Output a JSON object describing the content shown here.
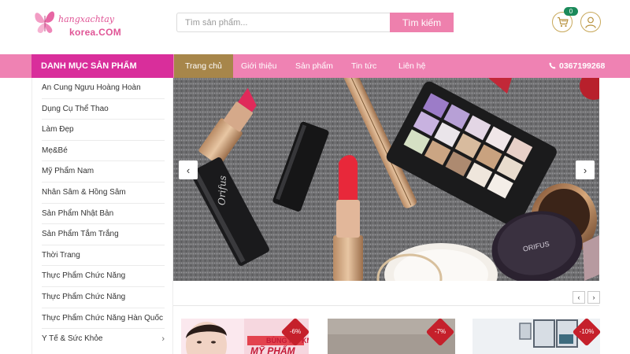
{
  "header": {
    "logo_line1": "hangxachtay",
    "logo_line2": "korea.COM",
    "search_placeholder": "Tìm sản phẩm...",
    "search_button": "Tìm kiếm",
    "cart_count": "0"
  },
  "nav": {
    "category_title": "DANH MỤC SẢN PHẨM",
    "items": [
      "Trang chủ",
      "Giới thiệu",
      "Sản phẩm",
      "Tin tức",
      "Liên hệ"
    ],
    "phone": "0367199268"
  },
  "sidebar": {
    "items": [
      "An Cung Ngưu Hoàng Hoàn",
      "Dụng Cụ Thể Thao",
      "Làm Đẹp",
      "Mẹ&Bé",
      "Mỹ Phẩm Nam",
      "Nhân Sâm & Hồng Sâm",
      "Sản Phẩm Nhật Bản",
      "Sản Phẩm Tắm Trắng",
      "Thời Trang",
      "Thực Phẩm Chức Năng",
      "Thực Phẩm Chức Năng",
      "Thực Phẩm Chức Năng Hàn Quốc",
      "Y Tế & Sức Khỏe"
    ]
  },
  "banner": {
    "brand_text": "Orifus",
    "compact_text": "ORIFUS"
  },
  "products": [
    {
      "discount": "-6%",
      "banner_text_1": "BÙNG NỔ KM",
      "banner_text_2": "MỸ PHẨM"
    },
    {
      "discount": "-7%"
    },
    {
      "discount": "-10%"
    }
  ],
  "colors": {
    "nav_pink": "#ef82b3",
    "category_magenta": "#d92e9b",
    "active_gold": "#a7864a",
    "search_button": "#ee80ad",
    "discount_red": "#c5202b"
  }
}
